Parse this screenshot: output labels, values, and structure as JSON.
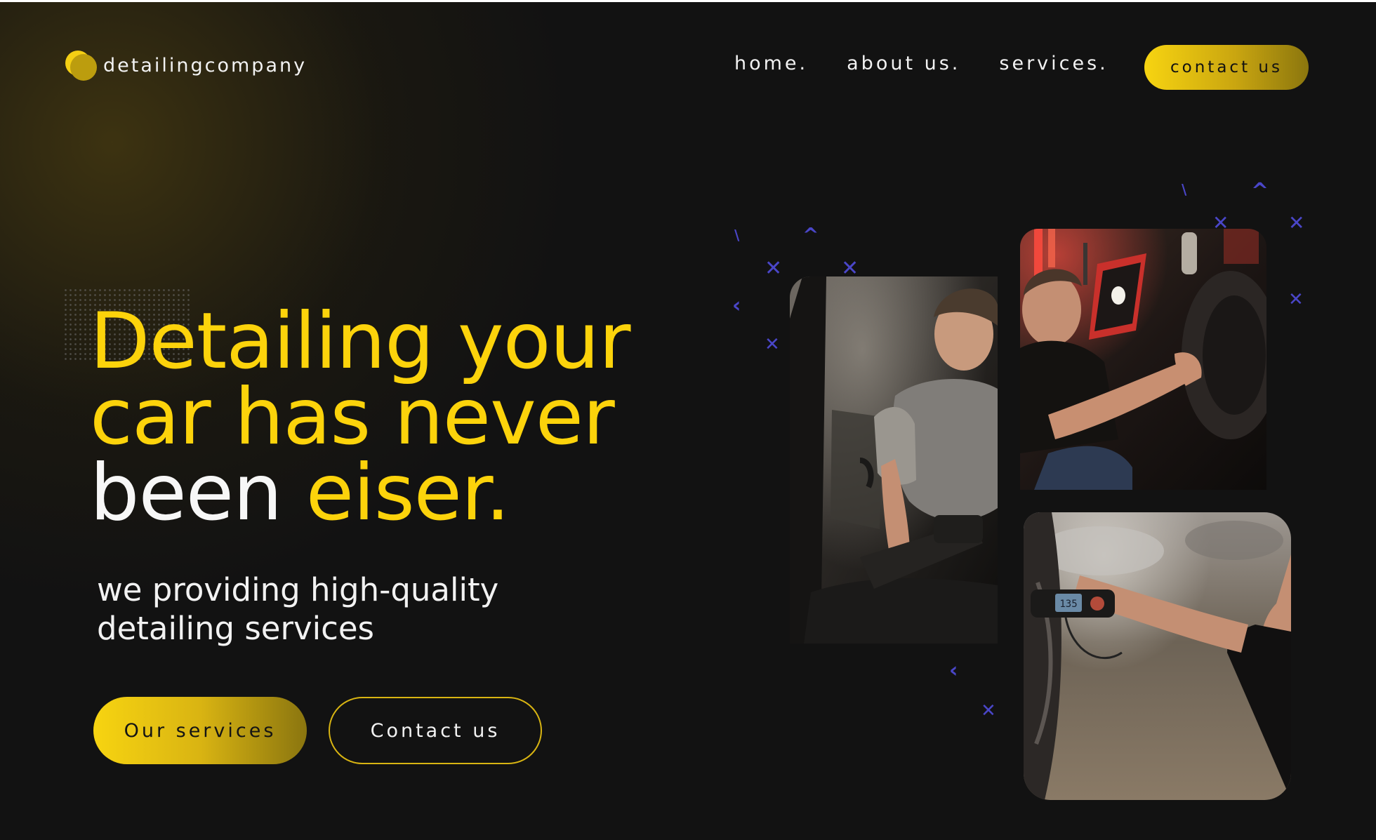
{
  "header": {
    "logo_text": "detailingcompany",
    "nav": [
      "home.",
      "about us.",
      "services."
    ],
    "contact_button": "contact us"
  },
  "hero": {
    "title_line_1": "Detailing your",
    "title_line_2": "car has never",
    "title_line_3_white": "been",
    "title_line_3_yellow": "eiser.",
    "subtitle_line_1": "we providing high-quality",
    "subtitle_line_2": "detailing services",
    "primary_button": "Our services",
    "secondary_button": "Contact us"
  },
  "photos": {
    "photo_1_alt": "man detailing car interior",
    "photo_2_alt": "man polishing car with a lamp",
    "photo_3_alt": "man measuring car paint thickness",
    "gauge_readout": "135"
  },
  "colors": {
    "background": "#121212",
    "accent_yellow": "#fcd30b",
    "deco_blue": "#4a46c8"
  }
}
